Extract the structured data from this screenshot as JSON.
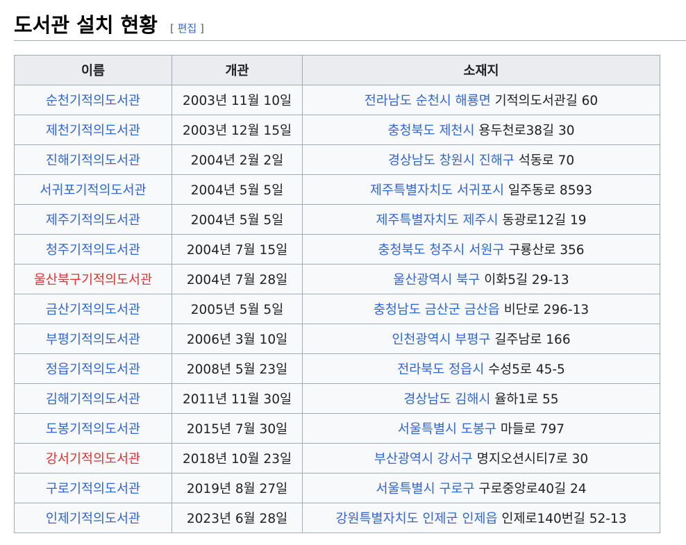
{
  "heading": {
    "title": "도서관 설치 현황",
    "edit_open": "[",
    "edit_label": "편집",
    "edit_close": "]"
  },
  "table": {
    "headers": [
      "이름",
      "개관",
      "소재지"
    ],
    "rows": [
      {
        "name": "순천기적의도서관",
        "red": false,
        "opened": "2003년 11월 10일",
        "addr_link": "전라남도 순천시 해룡면",
        "addr_rest": "기적의도서관길 60"
      },
      {
        "name": "제천기적의도서관",
        "red": false,
        "opened": "2003년 12월 15일",
        "addr_link": "충청북도 제천시",
        "addr_rest": "용두천로38길 30"
      },
      {
        "name": "진해기적의도서관",
        "red": false,
        "opened": "2004년 2월 2일",
        "addr_link": "경상남도 창원시 진해구",
        "addr_rest": "석동로 70"
      },
      {
        "name": "서귀포기적의도서관",
        "red": false,
        "opened": "2004년 5월 5일",
        "addr_link": "제주특별자치도 서귀포시",
        "addr_rest": "일주동로 8593"
      },
      {
        "name": "제주기적의도서관",
        "red": false,
        "opened": "2004년 5월 5일",
        "addr_link": "제주특별자치도 제주시",
        "addr_rest": "동광로12길 19"
      },
      {
        "name": "청주기적의도서관",
        "red": false,
        "opened": "2004년 7월 15일",
        "addr_link": "충청북도 청주시 서원구",
        "addr_rest": "구룡산로 356"
      },
      {
        "name": "울산북구기적의도서관",
        "red": true,
        "opened": "2004년 7월 28일",
        "addr_link": "울산광역시 북구",
        "addr_rest": "이화5길 29-13"
      },
      {
        "name": "금산기적의도서관",
        "red": false,
        "opened": "2005년 5월 5일",
        "addr_link": "충청남도 금산군 금산읍",
        "addr_rest": "비단로 296-13"
      },
      {
        "name": "부평기적의도서관",
        "red": false,
        "opened": "2006년 3월 10일",
        "addr_link": "인천광역시 부평구",
        "addr_rest": "길주남로 166"
      },
      {
        "name": "정읍기적의도서관",
        "red": false,
        "opened": "2008년 5월 23일",
        "addr_link": "전라북도 정읍시",
        "addr_rest": "수성5로 45-5"
      },
      {
        "name": "김해기적의도서관",
        "red": false,
        "opened": "2011년 11월 30일",
        "addr_link": "경상남도 김해시",
        "addr_rest": "율하1로 55"
      },
      {
        "name": "도봉기적의도서관",
        "red": false,
        "opened": "2015년 7월 30일",
        "addr_link": "서울특별시 도봉구",
        "addr_rest": "마들로 797"
      },
      {
        "name": "강서기적의도서관",
        "red": true,
        "opened": "2018년 10월 23일",
        "addr_link": "부산광역시 강서구",
        "addr_rest": "명지오션시티7로 30"
      },
      {
        "name": "구로기적의도서관",
        "red": false,
        "opened": "2019년 8월 27일",
        "addr_link": "서울특별시 구로구",
        "addr_rest": "구로중앙로40길 24"
      },
      {
        "name": "인제기적의도서관",
        "red": false,
        "opened": "2023년 6월 28일",
        "addr_link": "강원특별자치도 인제군 인제읍",
        "addr_rest": "인제로140번길 52-13"
      }
    ]
  },
  "colors": {
    "link": "#3366cc",
    "redlink": "#d33",
    "header_bg": "#eaecf0",
    "cell_bg": "#f8f9fa",
    "border": "#a2a9b1"
  }
}
